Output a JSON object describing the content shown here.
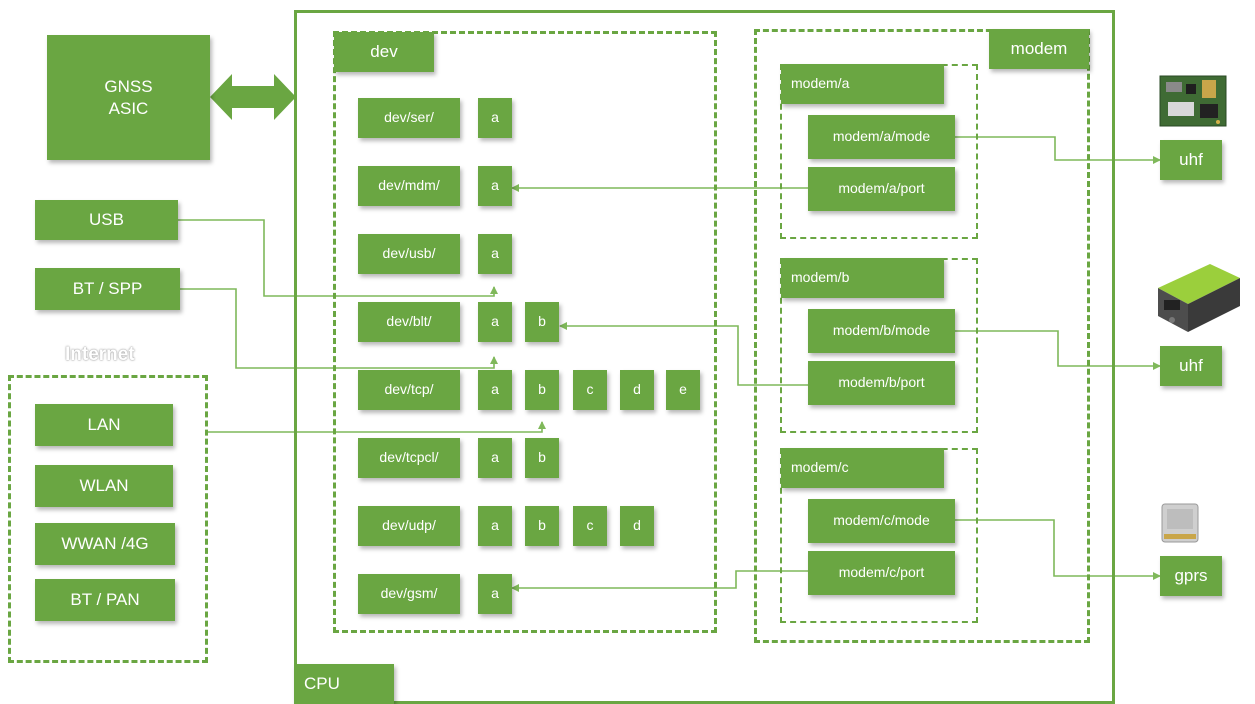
{
  "colors": {
    "box": "#6aa642",
    "line": "#7fb85a",
    "frame": "#6aa642",
    "text": "#ffffff"
  },
  "gnss": {
    "label": "GNSS\nASIC"
  },
  "cpu": {
    "label": "CPU"
  },
  "dev": {
    "title": "dev",
    "rows": [
      {
        "label": "dev/ser/",
        "ports": [
          "a"
        ]
      },
      {
        "label": "dev/mdm/",
        "ports": [
          "a"
        ]
      },
      {
        "label": "dev/usb/",
        "ports": [
          "a"
        ]
      },
      {
        "label": "dev/blt/",
        "ports": [
          "a",
          "b"
        ]
      },
      {
        "label": "dev/tcp/",
        "ports": [
          "a",
          "b",
          "c",
          "d",
          "e"
        ]
      },
      {
        "label": "dev/tcpcl/",
        "ports": [
          "a",
          "b"
        ]
      },
      {
        "label": "dev/udp/",
        "ports": [
          "a",
          "b",
          "c",
          "d"
        ]
      },
      {
        "label": "dev/gsm/",
        "ports": [
          "a"
        ]
      }
    ]
  },
  "modem": {
    "title": "modem",
    "groups": [
      {
        "title": "modem/a",
        "mode": "modem/a/mode",
        "port": "modem/a/port"
      },
      {
        "title": "modem/b",
        "mode": "modem/b/mode",
        "port": "modem/b/port"
      },
      {
        "title": "modem/c",
        "mode": "modem/c/mode",
        "port": "modem/c/port"
      }
    ]
  },
  "interfaces": {
    "usb": "USB",
    "bt_spp": "BT / SPP"
  },
  "internet": {
    "label": "Internet",
    "items": [
      "LAN",
      "WLAN",
      "WWAN /4G",
      "BT / PAN"
    ]
  },
  "radios": [
    {
      "label": "uhf",
      "icon": "radio-board-icon"
    },
    {
      "label": "uhf",
      "icon": "radio-module-icon"
    },
    {
      "label": "gprs",
      "icon": "gsm-module-icon"
    }
  ]
}
